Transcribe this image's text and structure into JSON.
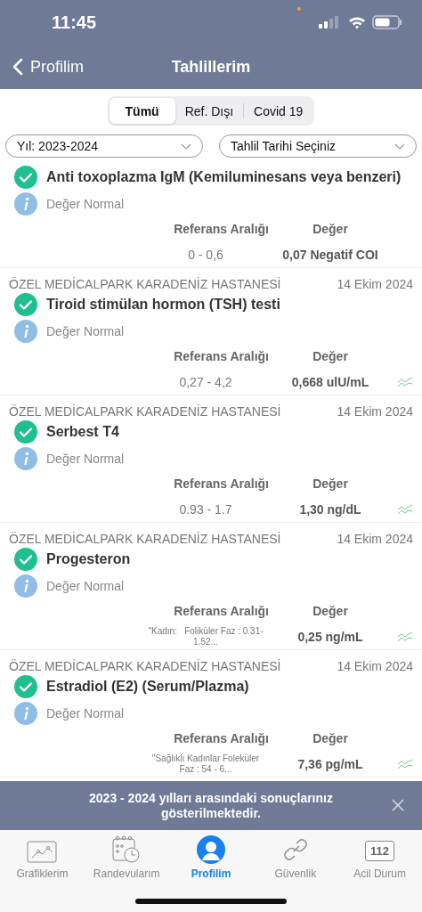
{
  "status_bar": {
    "time": "11:45"
  },
  "nav": {
    "back": "Profilim",
    "title": "Tahlillerim"
  },
  "segments": [
    {
      "label": "Tümü",
      "selected": true
    },
    {
      "label": "Ref. Dışı",
      "selected": false
    },
    {
      "label": "Covid 19",
      "selected": false
    }
  ],
  "filters": [
    {
      "value": "Yıl: 2023-2024"
    },
    {
      "value": "Tahlil Tarihi Seçiniz"
    }
  ],
  "results": [
    {
      "title": "Anti toxoplazma IgM (Kemiluminesans veya benzeri)",
      "normal": true,
      "status": "Değer Normal",
      "ref_label": "Referans Aralığı",
      "value_label": "Değer",
      "ref": "0 - 0,6",
      "ref_small": false,
      "value": "0,07 Negatif COI",
      "trend": false
    },
    {
      "hospital": "ÖZEL MEDİCALPARK KARADENİZ HASTANESİ",
      "date": "14 Ekim 2024",
      "title": "Tiroid stimülan hormon (TSH) testi",
      "normal": true,
      "status": "Değer Normal",
      "ref_label": "Referans Aralığı",
      "value_label": "Değer",
      "ref": "0,27 - 4,2",
      "ref_small": false,
      "value": "0,668 ulU/mL",
      "trend": true
    },
    {
      "hospital": "ÖZEL MEDİCALPARK KARADENİZ HASTANESİ",
      "date": "14 Ekim 2024",
      "title": "Serbest T4",
      "normal": true,
      "status": "Değer Normal",
      "ref_label": "Referans Aralığı",
      "value_label": "Değer",
      "ref": "0.93 - 1.7",
      "ref_small": false,
      "value": "1,30 ng/dL",
      "trend": true
    },
    {
      "hospital": "ÖZEL MEDİCALPARK KARADENİZ HASTANESİ",
      "date": "14 Ekim 2024",
      "title": "Progesteron",
      "normal": true,
      "status": "Değer Normal",
      "ref_label": "Referans Aralığı",
      "value_label": "Değer",
      "ref": "\"Kadın:   Foliküler Faz : 0.31-1.52...",
      "ref_small": true,
      "value": "0,25 ng/mL",
      "trend": true
    },
    {
      "hospital": "ÖZEL MEDİCALPARK KARADENİZ HASTANESİ",
      "date": "14 Ekim 2024",
      "title": "Estradiol (E2) (Serum/Plazma)",
      "normal": true,
      "status": "Değer Normal",
      "ref_label": "Referans Aralığı",
      "value_label": "Değer",
      "ref": "\"Sağlıklı Kadınlar Foleküler Faz : 54 - 6...",
      "ref_small": true,
      "value": "7,36 pg/mL",
      "trend": true
    }
  ],
  "banner": {
    "text": "2023 - 2024 yılları arasındaki sonuçlarınız gösterilmektedir."
  },
  "tabs": [
    {
      "kind": "chart",
      "label": "Grafiklerim",
      "selected": false
    },
    {
      "kind": "calendar",
      "label": "Randevularım",
      "selected": false
    },
    {
      "kind": "person",
      "label": "Profilim",
      "selected": true
    },
    {
      "kind": "link",
      "label": "Güvenlik",
      "selected": false
    },
    {
      "kind": "emergency",
      "label": "Acil Durum",
      "badge": "112",
      "selected": false
    }
  ]
}
